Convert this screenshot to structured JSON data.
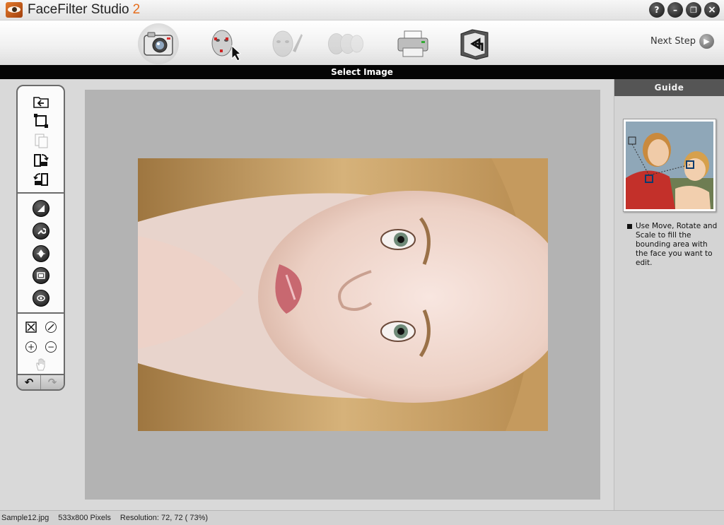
{
  "app": {
    "title": "FaceFilter Studio",
    "version": "2"
  },
  "window_controls": {
    "help": "?",
    "minimize": "–",
    "restore": "❐",
    "close": "×"
  },
  "steps": [
    {
      "name": "select-image",
      "icon": "camera-icon",
      "state": "active"
    },
    {
      "name": "locate-face",
      "icon": "face-locate-icon",
      "state": "enabled"
    },
    {
      "name": "edit-face",
      "icon": "face-edit-icon",
      "state": "disabled"
    },
    {
      "name": "morph-faces",
      "icon": "face-morph-icon",
      "state": "disabled"
    },
    {
      "name": "print",
      "icon": "printer-icon",
      "state": "enabled"
    },
    {
      "name": "export",
      "icon": "folder-export-icon",
      "state": "enabled"
    }
  ],
  "next_step_label": "Next Step",
  "section_title": "Select Image",
  "tools": {
    "file_group": [
      "open-image-icon",
      "crop-rotate-icon",
      "paste-icon",
      "rotate-right-icon",
      "rotate-left-icon"
    ],
    "adjust_group": [
      "brightness-icon",
      "wrench-icon",
      "level-icon",
      "color-balance-icon",
      "red-eye-icon"
    ],
    "view_group": [
      "fit-to-window-icon",
      "reset-icon",
      "zoom-in-icon",
      "zoom-out-icon",
      "hand-pan-icon"
    ],
    "undo": "↶",
    "redo": "↷"
  },
  "guide": {
    "header": "Guide",
    "text": "Use Move, Rotate and Scale to fill the bounding area with the face you want to edit."
  },
  "status": {
    "filename": "Sample12.jpg",
    "dimensions": "533x800 Pixels",
    "resolution": "Resolution: 72, 72 ( 73%)"
  }
}
